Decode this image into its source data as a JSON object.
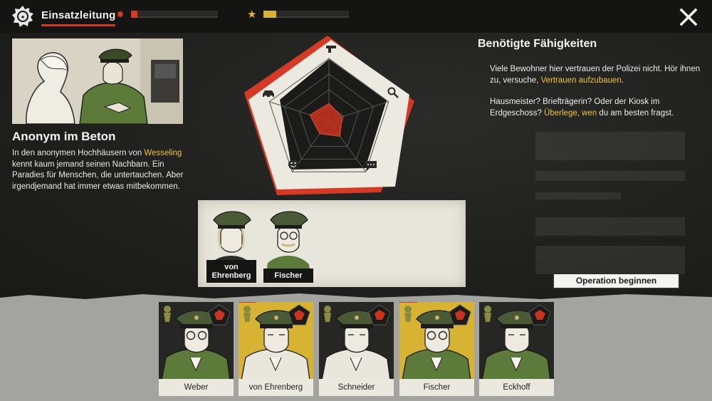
{
  "top_bar": {
    "title": "Einsatzleitung",
    "trouble_icon": "fire-hazard-icon",
    "trouble_level": 0.07,
    "reputation_icon": "star-icon",
    "reputation_level": 0.15,
    "close_icon": "close-icon"
  },
  "case": {
    "title": "Anonym im Beton",
    "desc_1": "In den anonymen Hochhäusern von ",
    "desc_hl": "Wesseling",
    "desc_2": " kennt kaum jemand seinen Nachbarn. Ein Paradies für Menschen, die untertauchen. Aber irgendjemand hat immer etwas mitbekommen."
  },
  "skills": {
    "title": "Benötigte Fähigkeiten",
    "p1_text": "Viele Bewohner hier vertrauen der Polizei nicht. Hör ihnen zu, versuche, ",
    "p1_hl": "Vertrauen aufzubauen",
    "p1_end": ".",
    "p2_text": "Hausmeister? Briefträgerin? Oder der Kiosk im Erdgeschoss? ",
    "p2_hl": "Überlege, wen",
    "p2_end": " du am besten fragst.",
    "radar_icons": [
      "gun-icon",
      "magnifier-icon",
      "speech-bubble-icon",
      "smiley-icon",
      "car-icon"
    ],
    "required_levels": [
      0.28,
      0.22,
      0.3,
      0.25,
      0.32
    ]
  },
  "team": {
    "members": [
      {
        "name": "von Ehrenberg"
      },
      {
        "name": "Fischer"
      }
    ]
  },
  "actions": {
    "start_label": "Operation beginnen"
  },
  "roster": [
    {
      "name": "Weber",
      "card": "dark",
      "selected": false
    },
    {
      "name": "von Ehrenberg",
      "card": "yellow",
      "selected": true
    },
    {
      "name": "Schneider",
      "card": "dark",
      "selected": false
    },
    {
      "name": "Fischer",
      "card": "yellow",
      "selected": true
    },
    {
      "name": "Eckhoff",
      "card": "dark",
      "selected": false
    }
  ],
  "colors": {
    "accent_red": "#d43a26",
    "accent_yellow": "#f0c23a",
    "uniform_green": "#5c7a3a"
  }
}
